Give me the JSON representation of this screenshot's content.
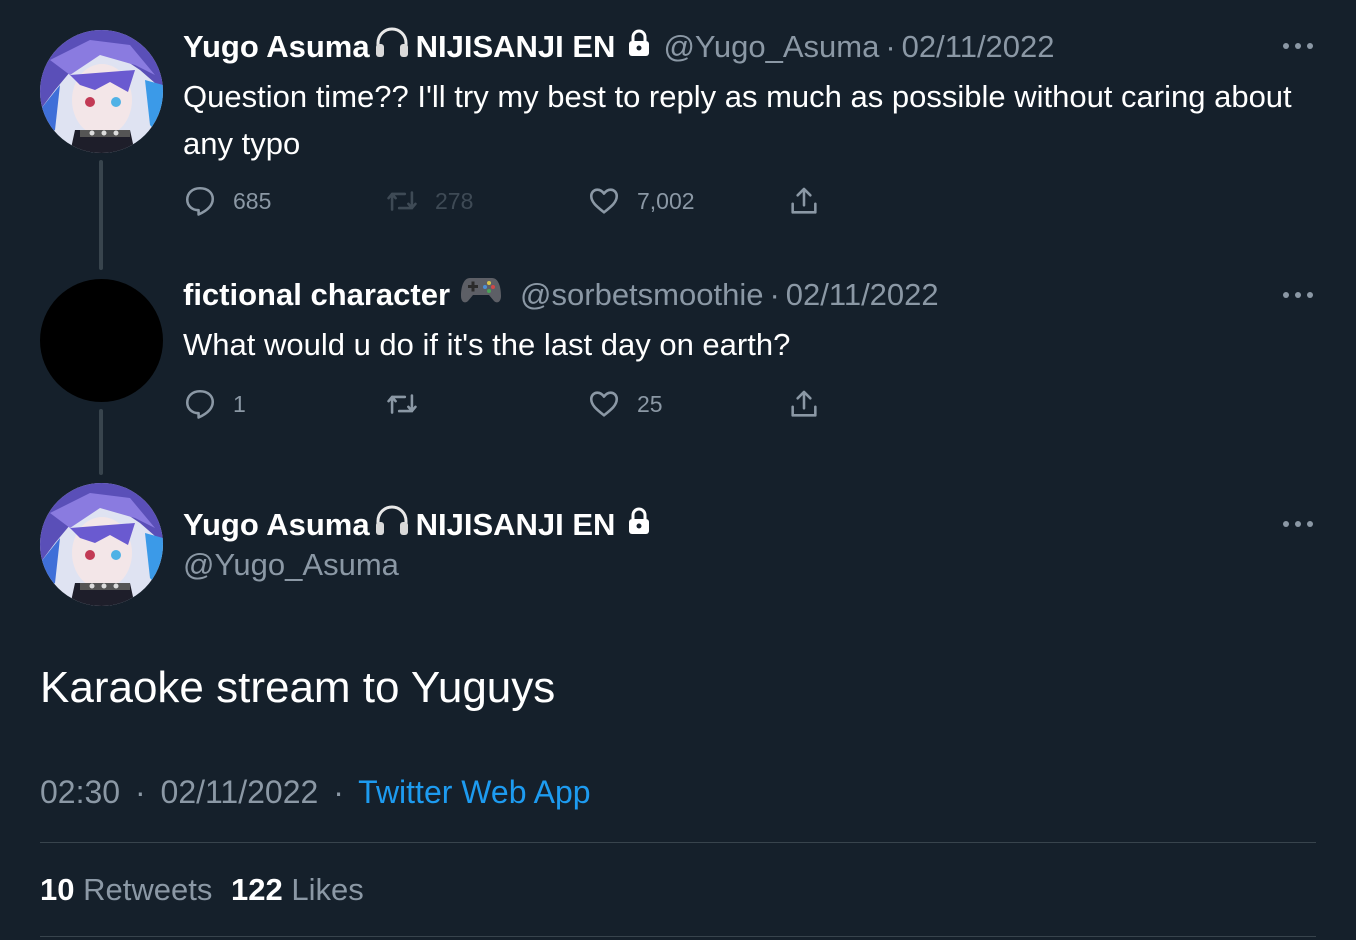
{
  "thread": [
    {
      "author_name": "Yugo Asuma",
      "author_suffix": "NIJISANJI EN",
      "handle": "@Yugo_Asuma",
      "date": "02/11/2022",
      "text": "Question time?? I'll try my best to reply as much as possible without caring about any typo",
      "name_emoji_icon": "headphones-icon",
      "protected_icon": "lock-icon",
      "replies": "685",
      "retweets": "278",
      "likes": "7,002"
    },
    {
      "author_name": "fictional character",
      "handle": "@sorbetsmoothie",
      "date": "02/11/2022",
      "text": "What would u do if it's the last day on earth?",
      "name_emoji_icon": "game-controller-icon",
      "replies": "1",
      "retweets": "",
      "likes": "25"
    }
  ],
  "main_tweet": {
    "author_name": "Yugo Asuma",
    "author_suffix": "NIJISANJI EN",
    "handle": "@Yugo_Asuma",
    "text": "Karaoke stream to Yuguys",
    "time": "02:30",
    "date": "02/11/2022",
    "separator": "·",
    "source": "Twitter Web App",
    "retweet_count": "10",
    "retweet_label": "Retweets",
    "like_count": "122",
    "like_label": "Likes"
  },
  "colors": {
    "background": "#15202b",
    "text_primary": "#ffffff",
    "text_secondary": "#8b98a5",
    "accent": "#1d9bf0",
    "border": "#38444d"
  }
}
